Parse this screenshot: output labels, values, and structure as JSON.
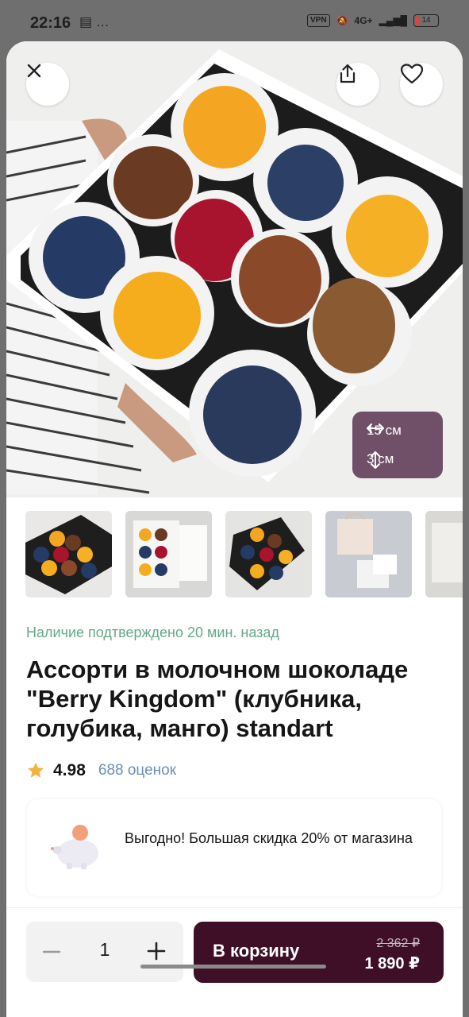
{
  "status_bar": {
    "time": "22:16",
    "extra": "…",
    "vpn": "VPN",
    "network": "4G+",
    "battery": "14"
  },
  "gallery": {
    "size_width": "15 см",
    "size_height": "3 см"
  },
  "product": {
    "availability": "Наличие подтверждено 20 мин. назад",
    "title": "Ассорти в молочном шоколаде \"Berry Kingdom\" (клубника, голубика, манго) standart",
    "rating": "4.98",
    "rating_count": "688 оценок"
  },
  "promo": {
    "text": "Выгодно! Большая скидка 20% от магазина"
  },
  "purchase": {
    "quantity": "1",
    "cart_label": "В корзину",
    "old_price": "2 362 ₽",
    "new_price": "1 890 ₽"
  },
  "colors": {
    "accent": "#3e0f27",
    "availability": "#62a889",
    "link": "#6b8fb8",
    "star": "#f2b33d"
  }
}
